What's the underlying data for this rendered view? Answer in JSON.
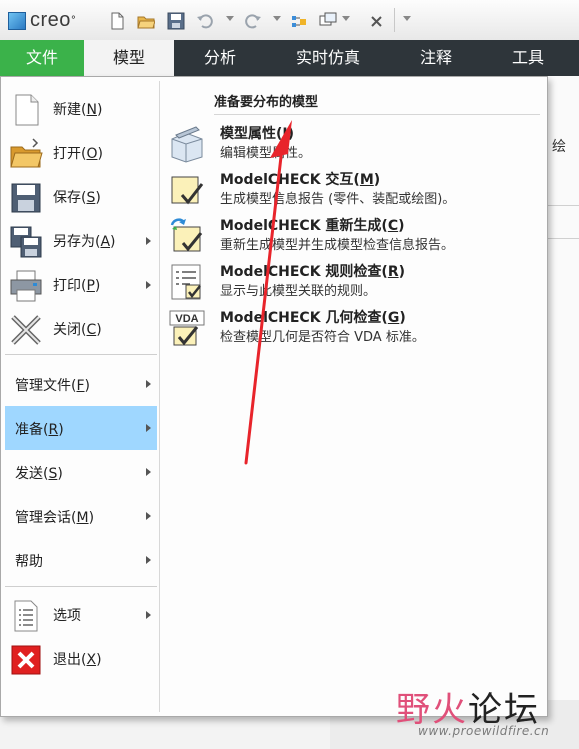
{
  "app": {
    "logo_text": "creo",
    "logo_mark": "°"
  },
  "quick_access": {
    "icons": [
      "new-file-icon",
      "open-folder-icon",
      "save-icon",
      "undo-icon",
      "redo-icon",
      "regenerate-icon",
      "window-icon",
      "close-window-icon",
      "customize-dropdown-icon"
    ]
  },
  "tabs": [
    {
      "label": "文件"
    },
    {
      "label": "模型"
    },
    {
      "label": "分析"
    },
    {
      "label": "实时仿真"
    },
    {
      "label": "注释"
    },
    {
      "label": "工具"
    }
  ],
  "file_menu": {
    "items": [
      {
        "label": "新建",
        "key": "N"
      },
      {
        "label": "打开",
        "key": "O"
      },
      {
        "label": "保存",
        "key": "S"
      },
      {
        "label": "另存为",
        "key": "A"
      },
      {
        "label": "打印",
        "key": "P"
      },
      {
        "label": "关闭",
        "key": "C"
      }
    ],
    "submenus": [
      {
        "label": "管理文件",
        "key": "F"
      },
      {
        "label": "准备",
        "key": "R"
      },
      {
        "label": "发送",
        "key": "S"
      },
      {
        "label": "管理会话",
        "key": "M"
      },
      {
        "label": "帮助",
        "key": ""
      }
    ],
    "footer": [
      {
        "label": "选项",
        "key": ""
      },
      {
        "label": "退出",
        "key": "X"
      }
    ]
  },
  "prepare_panel": {
    "header": "准备要分布的模型",
    "items": [
      {
        "title": "模型属性",
        "key": "I",
        "desc": "编辑模型属性。"
      },
      {
        "title": "ModelCHECK 交互",
        "key": "M",
        "desc": "生成模型信息报告 (零件、装配或绘图)。"
      },
      {
        "title": "ModelCHECK 重新生成",
        "key": "C",
        "desc": "重新生成模型并生成模型检查信息报告。"
      },
      {
        "title": "ModelCHECK 规则检查",
        "key": "R",
        "desc": "显示与此模型关联的规则。"
      },
      {
        "title": "ModelCHECK 几何检查",
        "key": "G",
        "desc": "检查模型几何是否符合 VDA 标准。"
      }
    ]
  },
  "background": {
    "partial_text": "绘"
  },
  "watermark": {
    "text_a": "野火",
    "text_b": "论坛",
    "url": "www.proewildfire.cn"
  },
  "colors": {
    "file_tab": "#3bb24a",
    "tab_bar": "#2e353a",
    "active_item": "#9fd7ff",
    "annotation": "#e8242b",
    "exit_icon": "#e02020"
  }
}
